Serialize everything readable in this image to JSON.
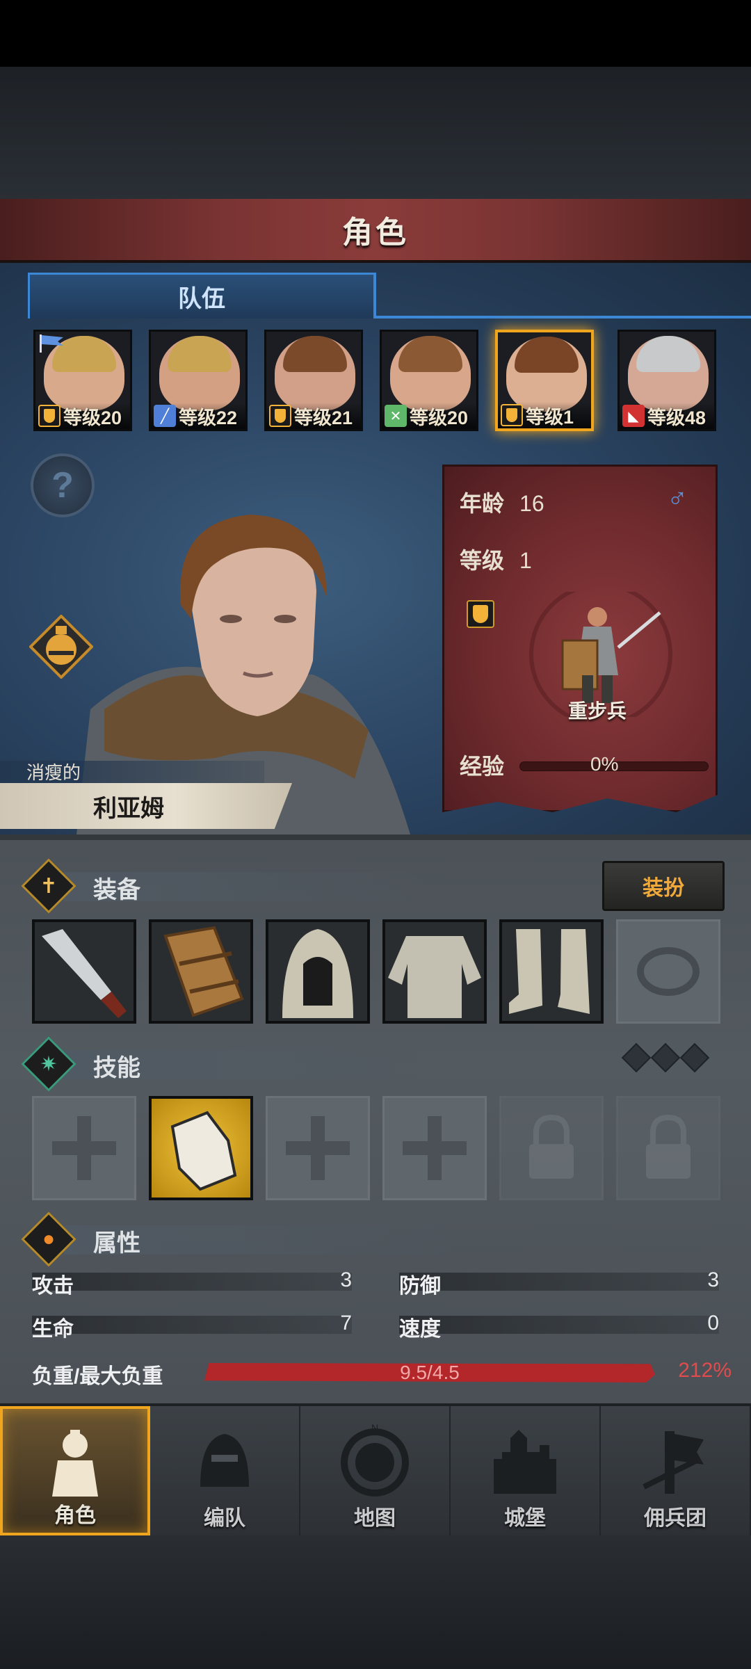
{
  "title": "角色",
  "tabs": [
    {
      "label": "队伍",
      "active": true
    }
  ],
  "party": [
    {
      "level_text": "等级20",
      "class_icon": "shield-icon",
      "class_color": "#f3b338",
      "hair": "#c9a452",
      "skin": "#d9a98c",
      "flag": true
    },
    {
      "level_text": "等级22",
      "class_icon": "sword-icon",
      "class_color": "#4f7fd6",
      "hair": "#c9a452",
      "skin": "#d4a084"
    },
    {
      "level_text": "等级21",
      "class_icon": "shield-icon",
      "class_color": "#f3b338",
      "hair": "#7a4a2a",
      "skin": "#d2a088"
    },
    {
      "level_text": "等级20",
      "class_icon": "crossed-swords-icon",
      "class_color": "#5fb86a",
      "hair": "#8b5a34",
      "skin": "#d8a68a"
    },
    {
      "level_text": "等级1",
      "class_icon": "shield-icon",
      "class_color": "#f3b338",
      "hair": "#7a4526",
      "skin": "#dcae92",
      "selected": true
    },
    {
      "level_text": "等级48",
      "class_icon": "wolf-icon",
      "class_color": "#d23232",
      "hair": "#c7c9cb",
      "skin": "#d4a894"
    }
  ],
  "character": {
    "epithet": "消瘦的",
    "name": "利亚姆",
    "age_label": "年龄",
    "age": "16",
    "gender_symbol": "♂",
    "level_label": "等级",
    "level": "1",
    "class_name": "重步兵",
    "exp_label": "经验",
    "exp_percent": "0%",
    "exp_fraction": 0
  },
  "equipment": {
    "label": "装备",
    "dress_button": "装扮",
    "slots": [
      "cleaver-weapon",
      "wooden-shield",
      "chainmail-hood",
      "chainmail-shirt",
      "chainmail-boots",
      "ring-empty"
    ]
  },
  "skills": {
    "label": "技能",
    "slots": [
      "empty",
      "gauntlet-skill",
      "empty",
      "empty",
      "locked",
      "locked"
    ],
    "points": 3
  },
  "attributes": {
    "label": "属性",
    "attack_label": "攻击",
    "attack": "3",
    "defense_label": "防御",
    "defense": "3",
    "hp_label": "生命",
    "hp": "7",
    "speed_label": "速度",
    "speed": "0",
    "weight_label": "负重/最大负重",
    "weight_value": "9.5/4.5",
    "weight_percent": "212%"
  },
  "nav": [
    {
      "label": "角色",
      "icon": "knight-icon",
      "active": true
    },
    {
      "label": "编队",
      "icon": "helmet-icon"
    },
    {
      "label": "地图",
      "icon": "compass-map-icon"
    },
    {
      "label": "城堡",
      "icon": "castle-icon"
    },
    {
      "label": "佣兵团",
      "icon": "banner-sword-icon"
    }
  ]
}
